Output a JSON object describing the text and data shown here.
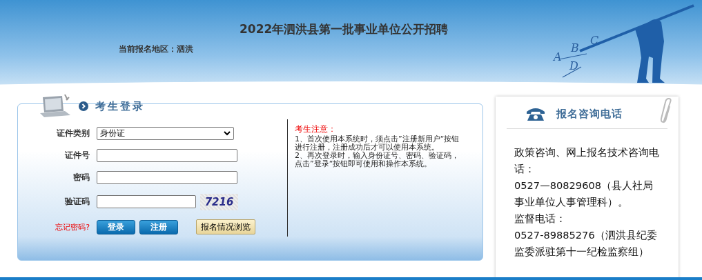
{
  "header": {
    "title": "2022年泗洪县第一批事业单位公开招聘",
    "region": "当前报名地区：泗洪",
    "banner_letters": [
      "A",
      "B",
      "C",
      "D"
    ]
  },
  "login": {
    "title": "考生登录",
    "fields": [
      {
        "kind": "select",
        "label": "证件类别",
        "value": "身份证"
      },
      {
        "kind": "text",
        "label": "证件号"
      },
      {
        "kind": "password",
        "label": "密码"
      },
      {
        "kind": "captcha",
        "label": "验证码",
        "captcha": "7216"
      }
    ],
    "forgot": "忘记密码?",
    "buttons": [
      "登录",
      "注册"
    ],
    "browse_button": "报名情况浏览",
    "notice": {
      "title": "考生注意：",
      "items": [
        "1、首次使用本系统时，须点击”注册新用户“按钮进行注册，注册成功后才可以使用本系统。",
        "2、再次登录时，输入身份证号、密码、验证码，点击”登录“按钮即可使用和操作本系统。"
      ]
    }
  },
  "contact": {
    "title": "报名咨询电话",
    "lines": [
      "政策咨询、网上报名技术咨询电话：",
      "0527—80829608（县人社局事业单位人事管理科）。",
      "监督电话：",
      "0527-89885276（泗洪县纪委监委派驻第十一纪检监察组）"
    ]
  }
}
